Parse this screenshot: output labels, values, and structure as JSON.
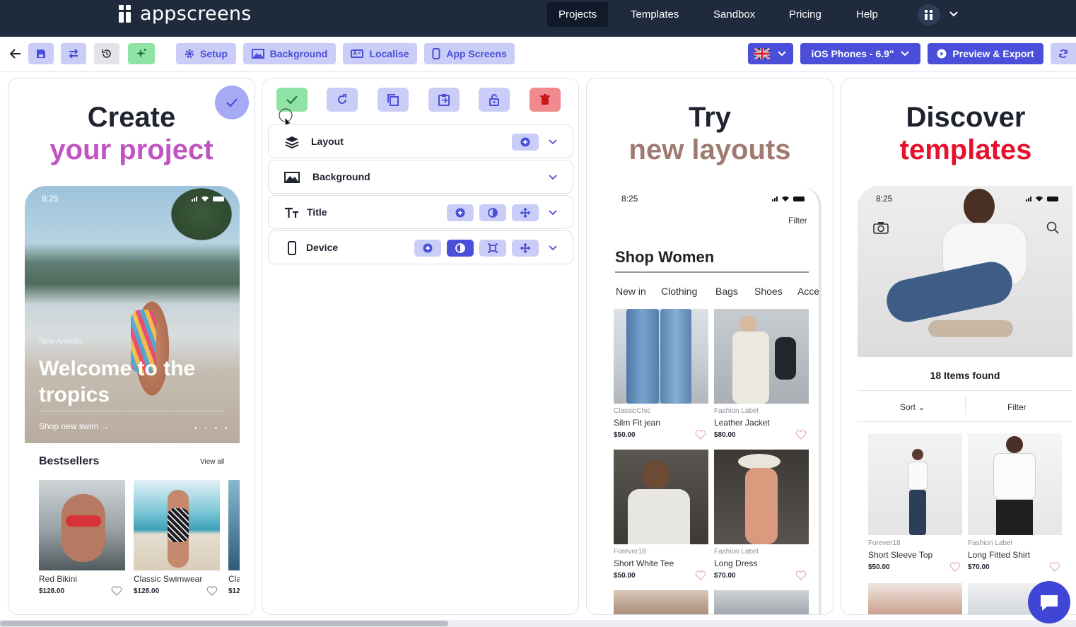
{
  "nav": {
    "logo": "appscreens",
    "items": [
      "Projects",
      "Templates",
      "Sandbox",
      "Pricing",
      "Help"
    ],
    "active": "Projects"
  },
  "toolbar": {
    "setup": "Setup",
    "background": "Background",
    "localise": "Localise",
    "app_screens": "App Screens",
    "device": "iOS Phones - 6.9\"",
    "preview": "Preview & Export"
  },
  "panel1": {
    "heading_line1": "Create",
    "heading_line2": "your project",
    "heading_color": "#c154c1",
    "time": "8:25",
    "hero_sub": "New Arrivals",
    "hero_title": "Welcome to the tropics",
    "hero_cta": "Shop new swim",
    "section": "Bestsellers",
    "view_all": "View all",
    "products": [
      {
        "name": "Red Bikini",
        "price": "$128.00"
      },
      {
        "name": "Classic Swimwear",
        "price": "$128.00"
      },
      {
        "name": "Cla",
        "price": "$12"
      }
    ]
  },
  "editor": {
    "sections": [
      {
        "label": "Layout"
      },
      {
        "label": "Background"
      },
      {
        "label": "Title"
      },
      {
        "label": "Device"
      }
    ]
  },
  "panel3": {
    "heading_line1": "Try",
    "heading_line2": "new layouts",
    "heading_color": "#a07a70",
    "time": "8:25",
    "filter": "Filter",
    "title": "Shop Women",
    "tabs": [
      "New in",
      "Clothing",
      "Bags",
      "Shoes",
      "Acce"
    ],
    "products": [
      {
        "brand": "ClassicChic",
        "name": "Silm Fit jean",
        "price": "$50.00"
      },
      {
        "brand": "Fashion Label",
        "name": "Leather Jacket",
        "price": "$80.00"
      },
      {
        "brand": "Forever18",
        "name": "Short White Tee",
        "price": "$50.00"
      },
      {
        "brand": "Fashion Label",
        "name": "Long Dress",
        "price": "$70.00"
      }
    ]
  },
  "panel4": {
    "heading_line1": "Discover",
    "heading_line2": "templates",
    "heading_color": "#e8112d",
    "time": "8:25",
    "found": "18 Items found",
    "sort": "Sort",
    "filter": "Filter",
    "products": [
      {
        "brand": "Forever18",
        "name": "Short Sleeve Top",
        "price": "$50.00"
      },
      {
        "brand": "Fashion Label",
        "name": "Long Fitted Shirt",
        "price": "$70.00"
      }
    ]
  }
}
